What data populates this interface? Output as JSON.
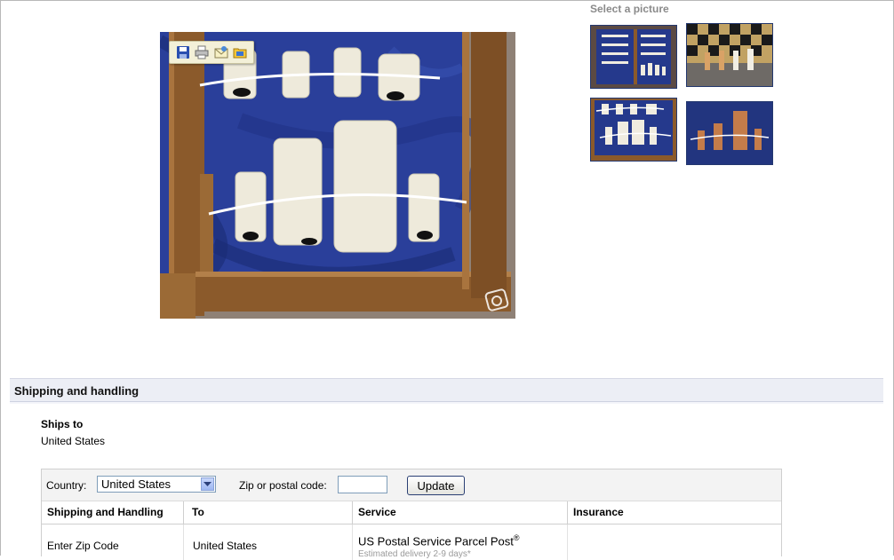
{
  "gallery": {
    "title": "Select a picture",
    "toolbar_icons": [
      "save-icon",
      "print-icon",
      "email-icon",
      "open-folder-icon"
    ],
    "thumbnails": [
      {
        "name": "thumbnail-1",
        "selected": true
      },
      {
        "name": "thumbnail-2",
        "selected": false
      },
      {
        "name": "thumbnail-3",
        "selected": false
      },
      {
        "name": "thumbnail-4",
        "selected": false
      }
    ]
  },
  "shipping": {
    "section_title": "Shipping and handling",
    "ships_to_label": "Ships to",
    "ships_to_value": "United States",
    "country_label": "Country:",
    "country_selected": "United States",
    "zip_label": "Zip or postal code:",
    "zip_value": "",
    "update_label": "Update",
    "columns": [
      "Shipping and Handling",
      "To",
      "Service",
      "Insurance"
    ],
    "rows": [
      {
        "cost": "Enter Zip Code",
        "to": "United States",
        "service": "US Postal Service Parcel Post",
        "service_mark": "®",
        "estimate": "Estimated delivery 2-9 days*",
        "insurance": ""
      }
    ]
  },
  "colors": {
    "header_bg": "#eceef5",
    "thumb_border": "#24386f",
    "velvet_blue": "#243c8f",
    "wood": "#8b5a2b"
  }
}
